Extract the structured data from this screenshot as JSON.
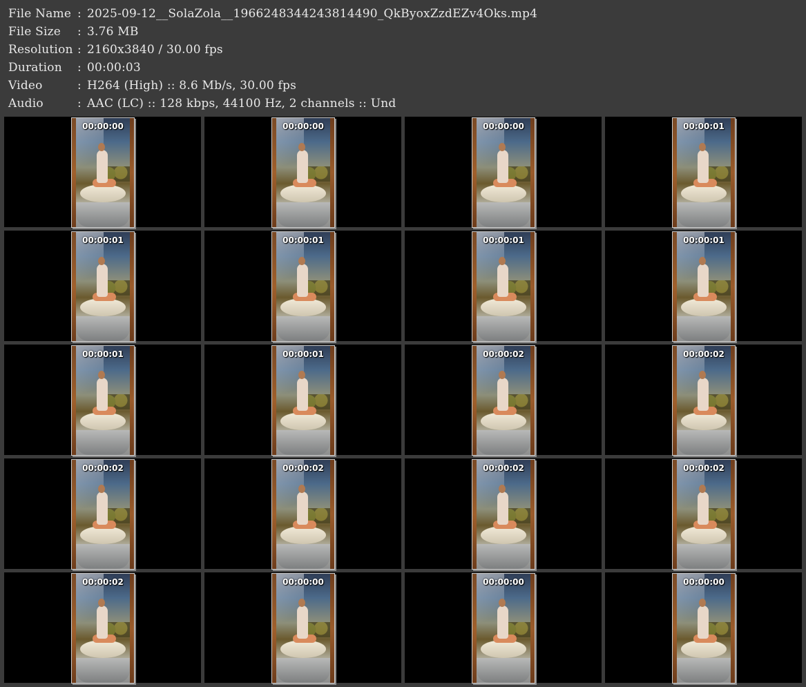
{
  "info": {
    "filename": {
      "label": "File Name",
      "value": "2025-09-12__SolaZola__1966248344243814490_QkByoxZzdEZv4Oks.mp4"
    },
    "filesize": {
      "label": "File Size",
      "value": "3.76 MB"
    },
    "resolution": {
      "label": "Resolution",
      "value": "2160x3840 / 30.00 fps"
    },
    "duration": {
      "label": "Duration",
      "value": "00:00:03"
    },
    "video": {
      "label": "Video",
      "value": "H264 (High) :: 8.6 Mb/s, 30.00 fps"
    },
    "audio": {
      "label": "Audio",
      "value": "AAC (LC) :: 128 kbps, 44100 Hz, 2 channels :: Und"
    },
    "separator": ":"
  },
  "thumbnails": [
    "00:00:00",
    "00:00:00",
    "00:00:00",
    "00:00:01",
    "00:00:01",
    "00:00:01",
    "00:00:01",
    "00:00:01",
    "00:00:01",
    "00:00:01",
    "00:00:02",
    "00:00:02",
    "00:00:02",
    "00:00:02",
    "00:00:02",
    "00:00:02",
    "00:00:02",
    "00:00:00",
    "00:00:00",
    "00:00:00"
  ]
}
